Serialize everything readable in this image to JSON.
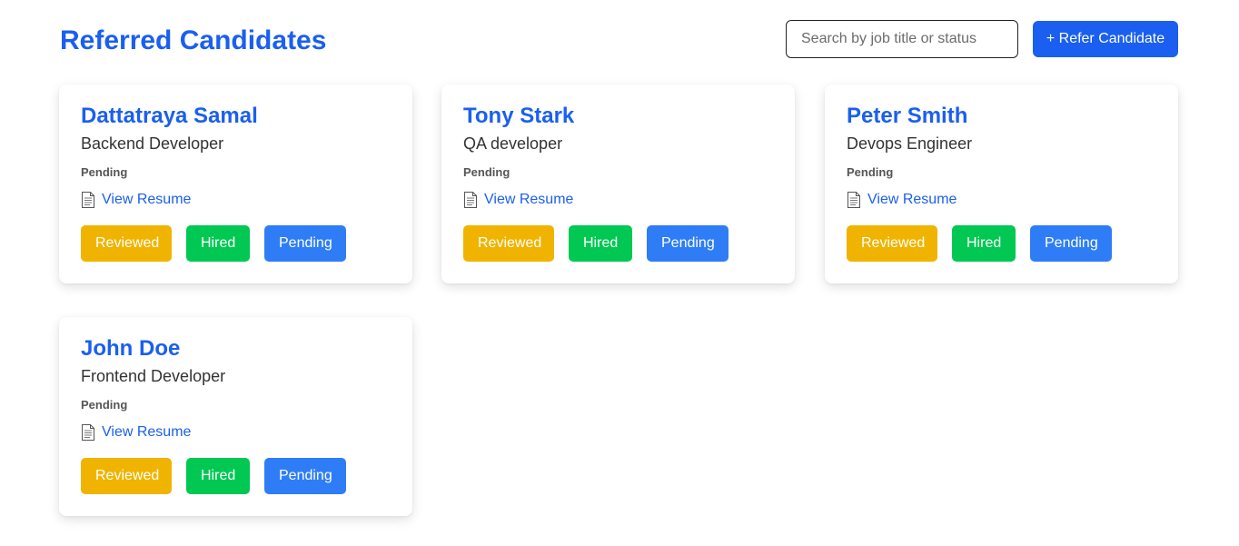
{
  "header": {
    "title": "Referred Candidates",
    "search_placeholder": "Search by job title or status",
    "refer_button_label": "+ Refer Candidate"
  },
  "colors": {
    "accent": "#1a5ff0",
    "reviewed": "#f0b400",
    "hired": "#00c853",
    "pending": "#2f7df6"
  },
  "candidates": [
    {
      "name": "Dattatraya Samal",
      "role": "Backend Developer",
      "status": "Pending",
      "resume_label": "View Resume",
      "resume_icon": "document-icon",
      "actions": {
        "reviewed": "Reviewed",
        "hired": "Hired",
        "pending": "Pending"
      }
    },
    {
      "name": "Tony Stark",
      "role": "QA developer",
      "status": "Pending",
      "resume_label": "View Resume",
      "resume_icon": "document-icon",
      "actions": {
        "reviewed": "Reviewed",
        "hired": "Hired",
        "pending": "Pending"
      }
    },
    {
      "name": "Peter Smith",
      "role": "Devops Engineer",
      "status": "Pending",
      "resume_label": "View Resume",
      "resume_icon": "document-icon",
      "actions": {
        "reviewed": "Reviewed",
        "hired": "Hired",
        "pending": "Pending"
      }
    },
    {
      "name": "John Doe",
      "role": "Frontend Developer",
      "status": "Pending",
      "resume_label": "View Resume",
      "resume_icon": "document-icon",
      "actions": {
        "reviewed": "Reviewed",
        "hired": "Hired",
        "pending": "Pending"
      }
    }
  ]
}
